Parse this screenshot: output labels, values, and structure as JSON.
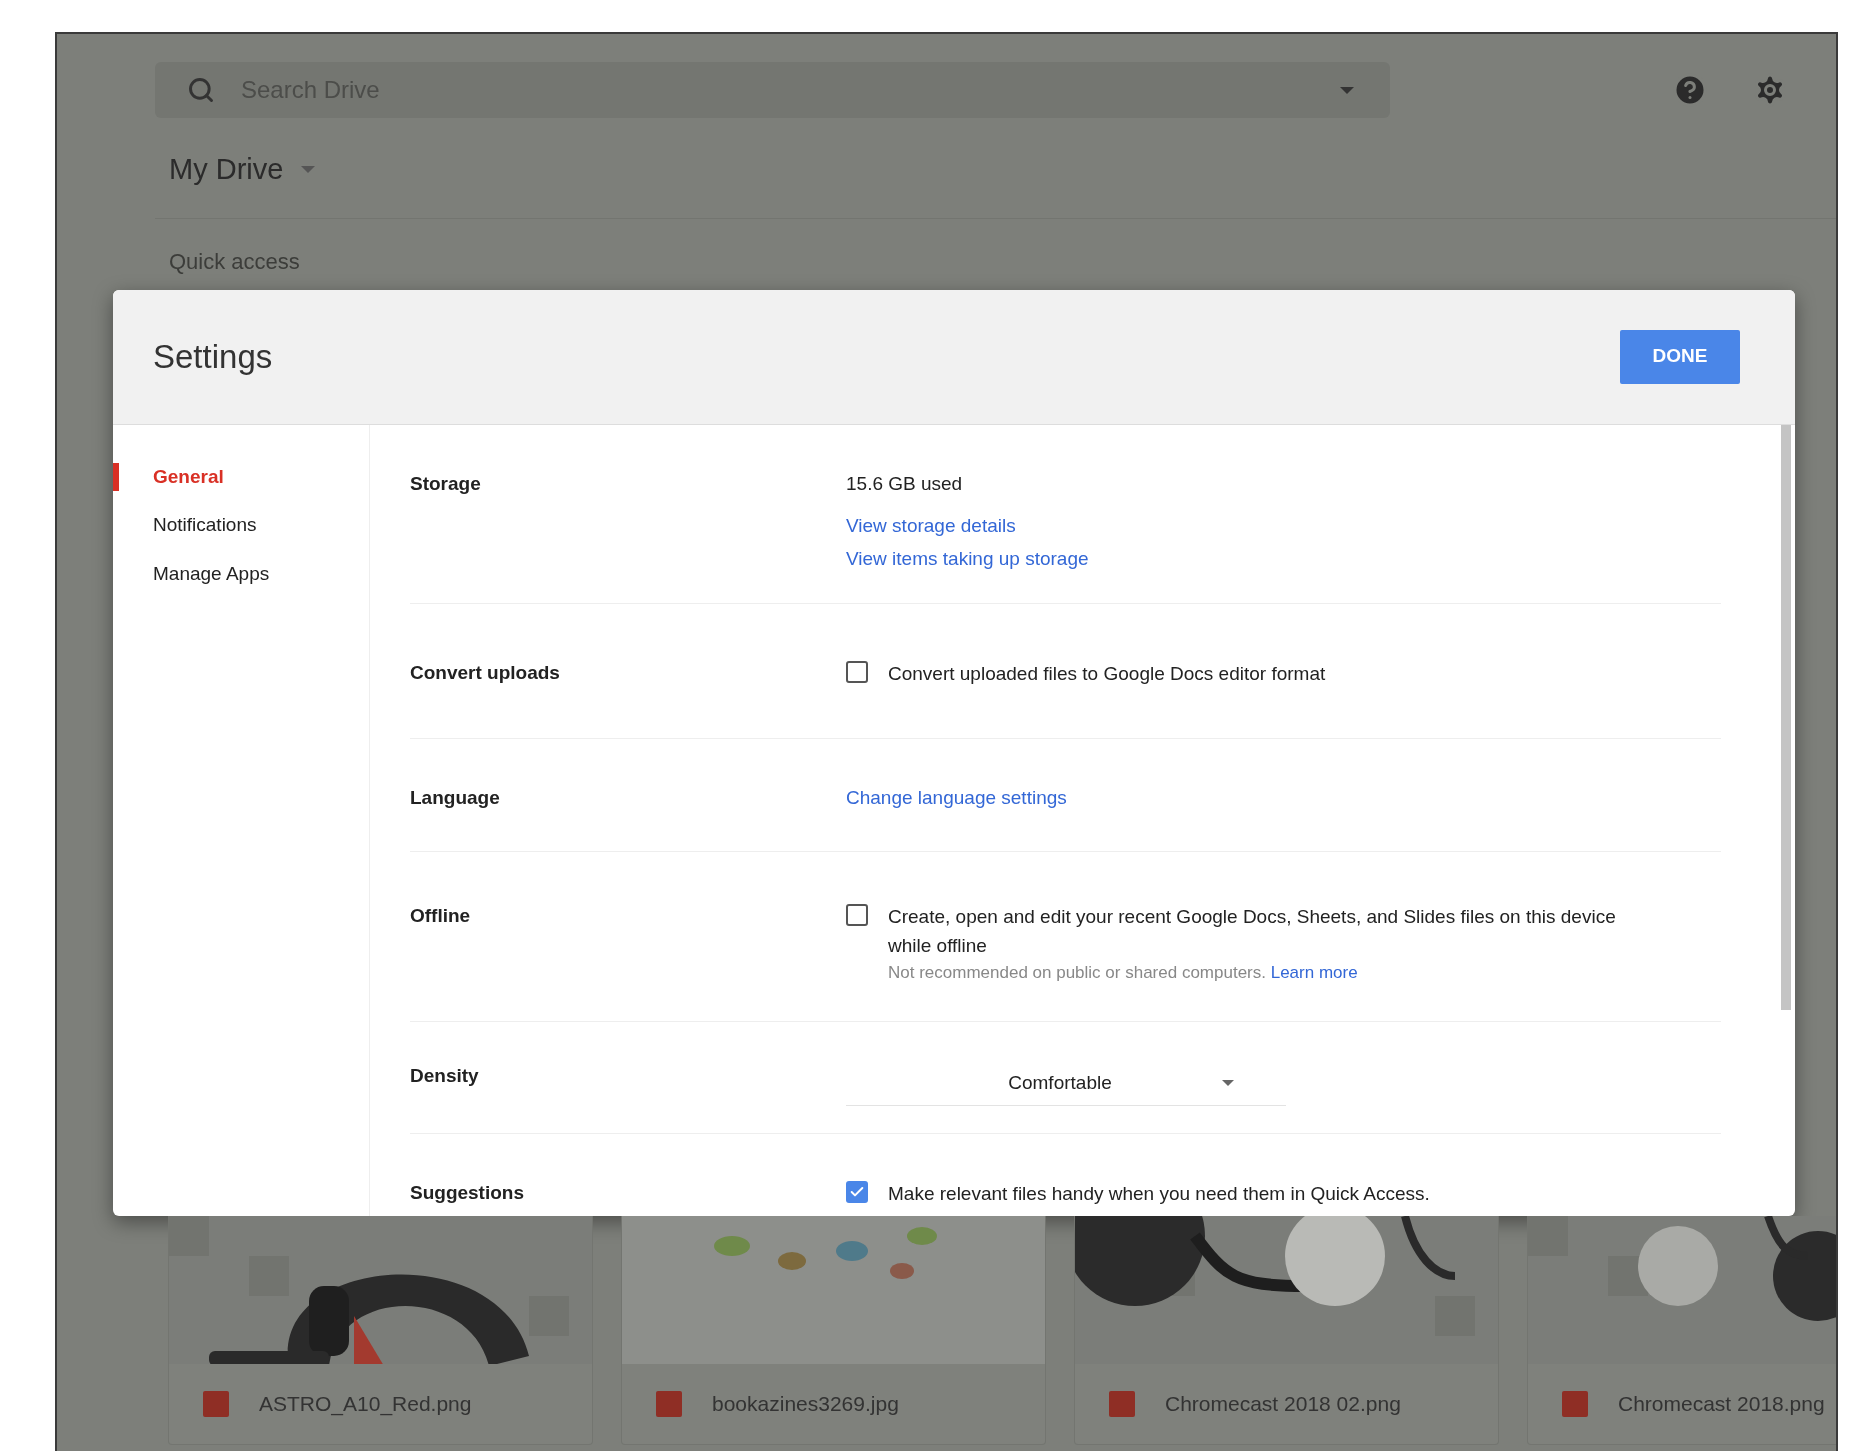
{
  "search": {
    "placeholder": "Search Drive"
  },
  "location": {
    "label": "My Drive"
  },
  "section_title": "Quick access",
  "dialog": {
    "title": "Settings",
    "done_button": "DONE",
    "nav": [
      {
        "label": "General",
        "selected": true
      },
      {
        "label": "Notifications",
        "selected": false
      },
      {
        "label": "Manage Apps",
        "selected": false
      }
    ],
    "settings": [
      {
        "kind": "storage",
        "label": "Storage",
        "usage": "15.6 GB used",
        "links": [
          "View storage details",
          "View items taking up storage"
        ]
      },
      {
        "kind": "checkbox",
        "label": "Convert uploads",
        "text": "Convert uploaded files to Google Docs editor format",
        "checked": false
      },
      {
        "kind": "link",
        "label": "Language",
        "link": "Change language settings"
      },
      {
        "kind": "checkbox",
        "label": "Offline",
        "text": "Create, open and edit your recent Google Docs, Sheets, and Slides files on this device while offline",
        "checked": false,
        "note": "Not recommended on public or shared computers.",
        "note_link": "Learn more"
      },
      {
        "kind": "select",
        "label": "Density",
        "value": "Comfortable"
      },
      {
        "kind": "checkbox",
        "label": "Suggestions",
        "text": "Make relevant files handy when you need them in Quick Access.",
        "checked": true
      }
    ]
  },
  "files": [
    {
      "name": "ASTRO_A10_Red.png"
    },
    {
      "name": "bookazines3269.jpg"
    },
    {
      "name": "Chromecast 2018 02.png"
    },
    {
      "name": "Chromecast 2018.png"
    }
  ]
}
